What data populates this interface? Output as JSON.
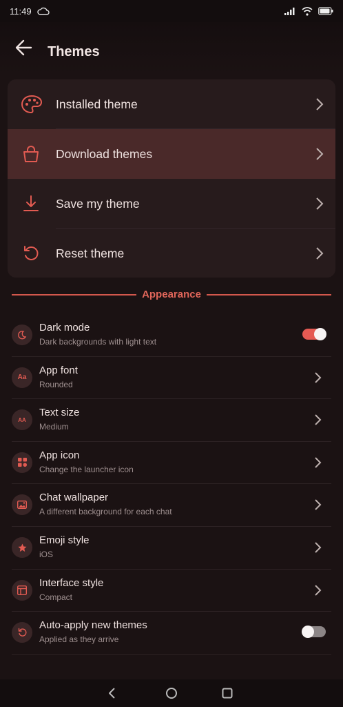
{
  "status_bar": {
    "time": "11:49",
    "cloud_icon": "cloud-icon",
    "signal_icon": "signal-icon",
    "wifi_icon": "wifi-icon",
    "battery_icon": "battery-icon"
  },
  "header": {
    "title": "Themes",
    "back_icon": "back-arrow-icon"
  },
  "theme_menu": [
    {
      "label": "Installed theme",
      "icon": "palette-icon",
      "active": false
    },
    {
      "label": "Download themes",
      "icon": "shopping-bag-icon",
      "active": true
    },
    {
      "label": "Save my theme",
      "icon": "download-icon",
      "active": false
    },
    {
      "label": "Reset theme",
      "icon": "reset-icon",
      "active": false
    }
  ],
  "appearance": {
    "title": "Appearance",
    "items": [
      {
        "title": "Dark mode",
        "subtitle": "Dark backgrounds with light text",
        "icon": "moon-icon",
        "control": "toggle",
        "value": true
      },
      {
        "title": "App font",
        "subtitle": "Rounded",
        "icon": "font-icon",
        "icon_text": "Aa",
        "control": "chevron"
      },
      {
        "title": "Text size",
        "subtitle": "Medium",
        "icon": "text-size-icon",
        "icon_text": "AA",
        "control": "chevron"
      },
      {
        "title": "App icon",
        "subtitle": "Change the launcher icon",
        "icon": "grid-icon",
        "control": "chevron"
      },
      {
        "title": "Chat wallpaper",
        "subtitle": "A different background for each chat",
        "icon": "image-icon",
        "control": "chevron"
      },
      {
        "title": "Emoji style",
        "subtitle": "iOS",
        "icon": "star-icon",
        "control": "chevron"
      },
      {
        "title": "Interface style",
        "subtitle": "Compact",
        "icon": "layout-icon",
        "control": "chevron"
      },
      {
        "title": "Auto-apply new themes",
        "subtitle": "Applied as they arrive",
        "icon": "refresh-icon",
        "control": "toggle",
        "value": false
      }
    ]
  },
  "nav_bar": {
    "back": "nav-back-icon",
    "home": "nav-home-icon",
    "recents": "nav-recents-icon"
  },
  "colors": {
    "accent": "#e25b52",
    "background": "#1b1213",
    "card": "#271b1c",
    "active_row": "#4a2929"
  }
}
